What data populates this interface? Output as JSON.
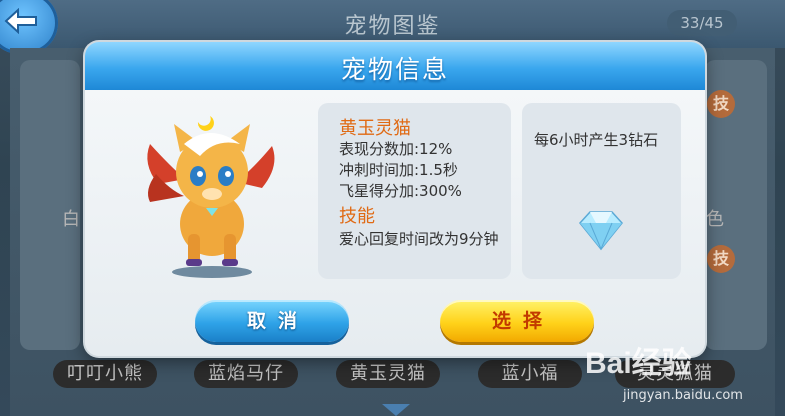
{
  "background": {
    "title": "宠物图鉴",
    "count": "33/45",
    "skill_badge": "技",
    "partial_left": "白",
    "partial_right": "色",
    "names": [
      "叮叮小熊",
      "蓝焰马仔",
      "黄玉灵猫",
      "蓝小福",
      "猫"
    ],
    "partial_name_last": "灵灵狐猫"
  },
  "dialog": {
    "title": "宠物信息",
    "pet": {
      "name": "黄玉灵猫",
      "stats": [
        "表现分数加:12%",
        "冲刺时间加:1.5秒",
        "飞星得分加:300%"
      ],
      "skill_heading": "技能",
      "skill_desc": "爱心回复时间改为9分钟"
    },
    "description": "每6小时产生3钻石",
    "buttons": {
      "cancel": "取消",
      "select": "选择"
    }
  },
  "watermark": {
    "main": "Bai经验",
    "url": "jingyan.baidu.com"
  },
  "colors": {
    "accent_blue": "#2fa3e8",
    "accent_yellow": "#ffd21a",
    "name_orange": "#e06a14"
  }
}
